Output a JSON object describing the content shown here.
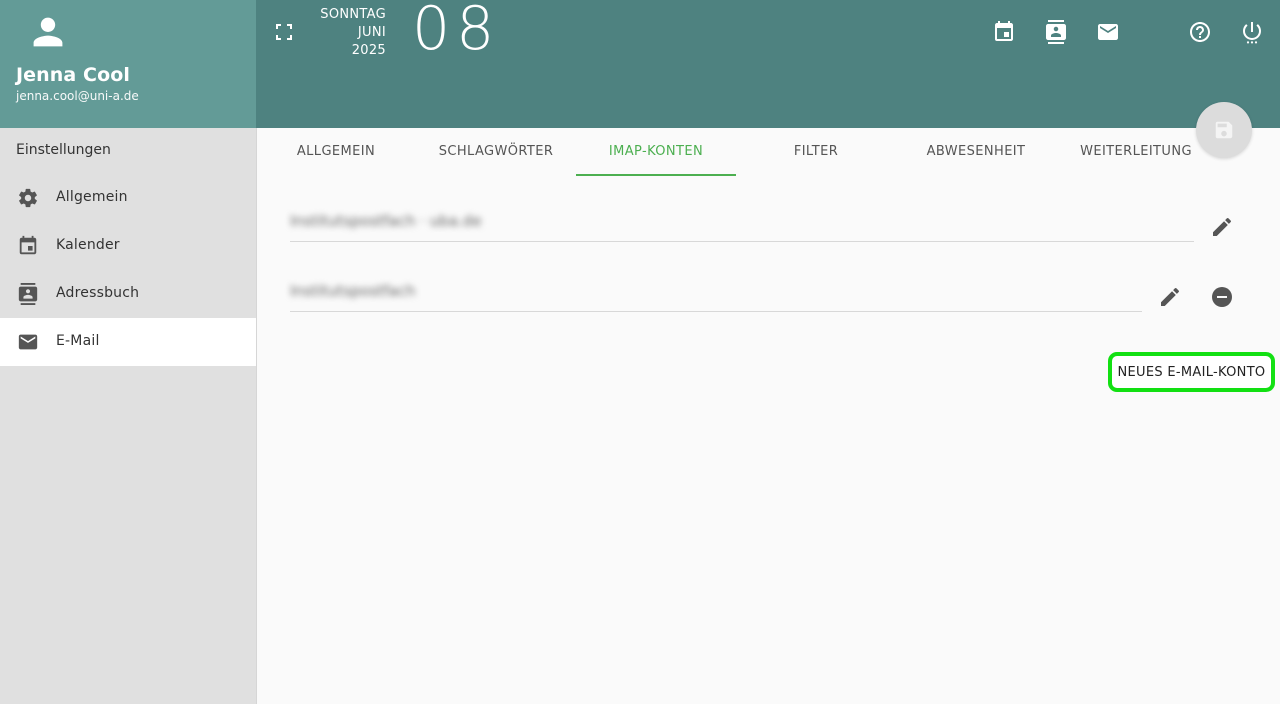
{
  "user": {
    "name": "Jenna Cool",
    "email": "jenna.cool@uni-a.de"
  },
  "sidebar": {
    "title": "Einstellungen",
    "items": [
      {
        "label": "Allgemein",
        "icon": "gear-icon"
      },
      {
        "label": "Kalender",
        "icon": "calendar-icon"
      },
      {
        "label": "Adressbuch",
        "icon": "contacts-icon"
      },
      {
        "label": "E-Mail",
        "icon": "mail-icon",
        "active": true
      }
    ]
  },
  "header": {
    "weekday": "SONNTAG",
    "month": "JUNI",
    "year": "2025",
    "day": "08"
  },
  "tabs": [
    {
      "label": "ALLGEMEIN"
    },
    {
      "label": "SCHLAGWÖRTER"
    },
    {
      "label": "IMAP-KONTEN",
      "active": true
    },
    {
      "label": "FILTER"
    },
    {
      "label": "ABWESENHEIT"
    },
    {
      "label": "WEITERLEITUNG"
    }
  ],
  "accounts": [
    {
      "label": "Institutspostfach · uba.de"
    },
    {
      "label": "Institutspostfach"
    }
  ],
  "actions": {
    "new_account_label": "NEUES E-MAIL-KONTO"
  },
  "colors": {
    "header_bg": "#4e8280",
    "user_panel_bg": "#639b97",
    "accent": "#4caf50",
    "highlight": "#12e012"
  }
}
